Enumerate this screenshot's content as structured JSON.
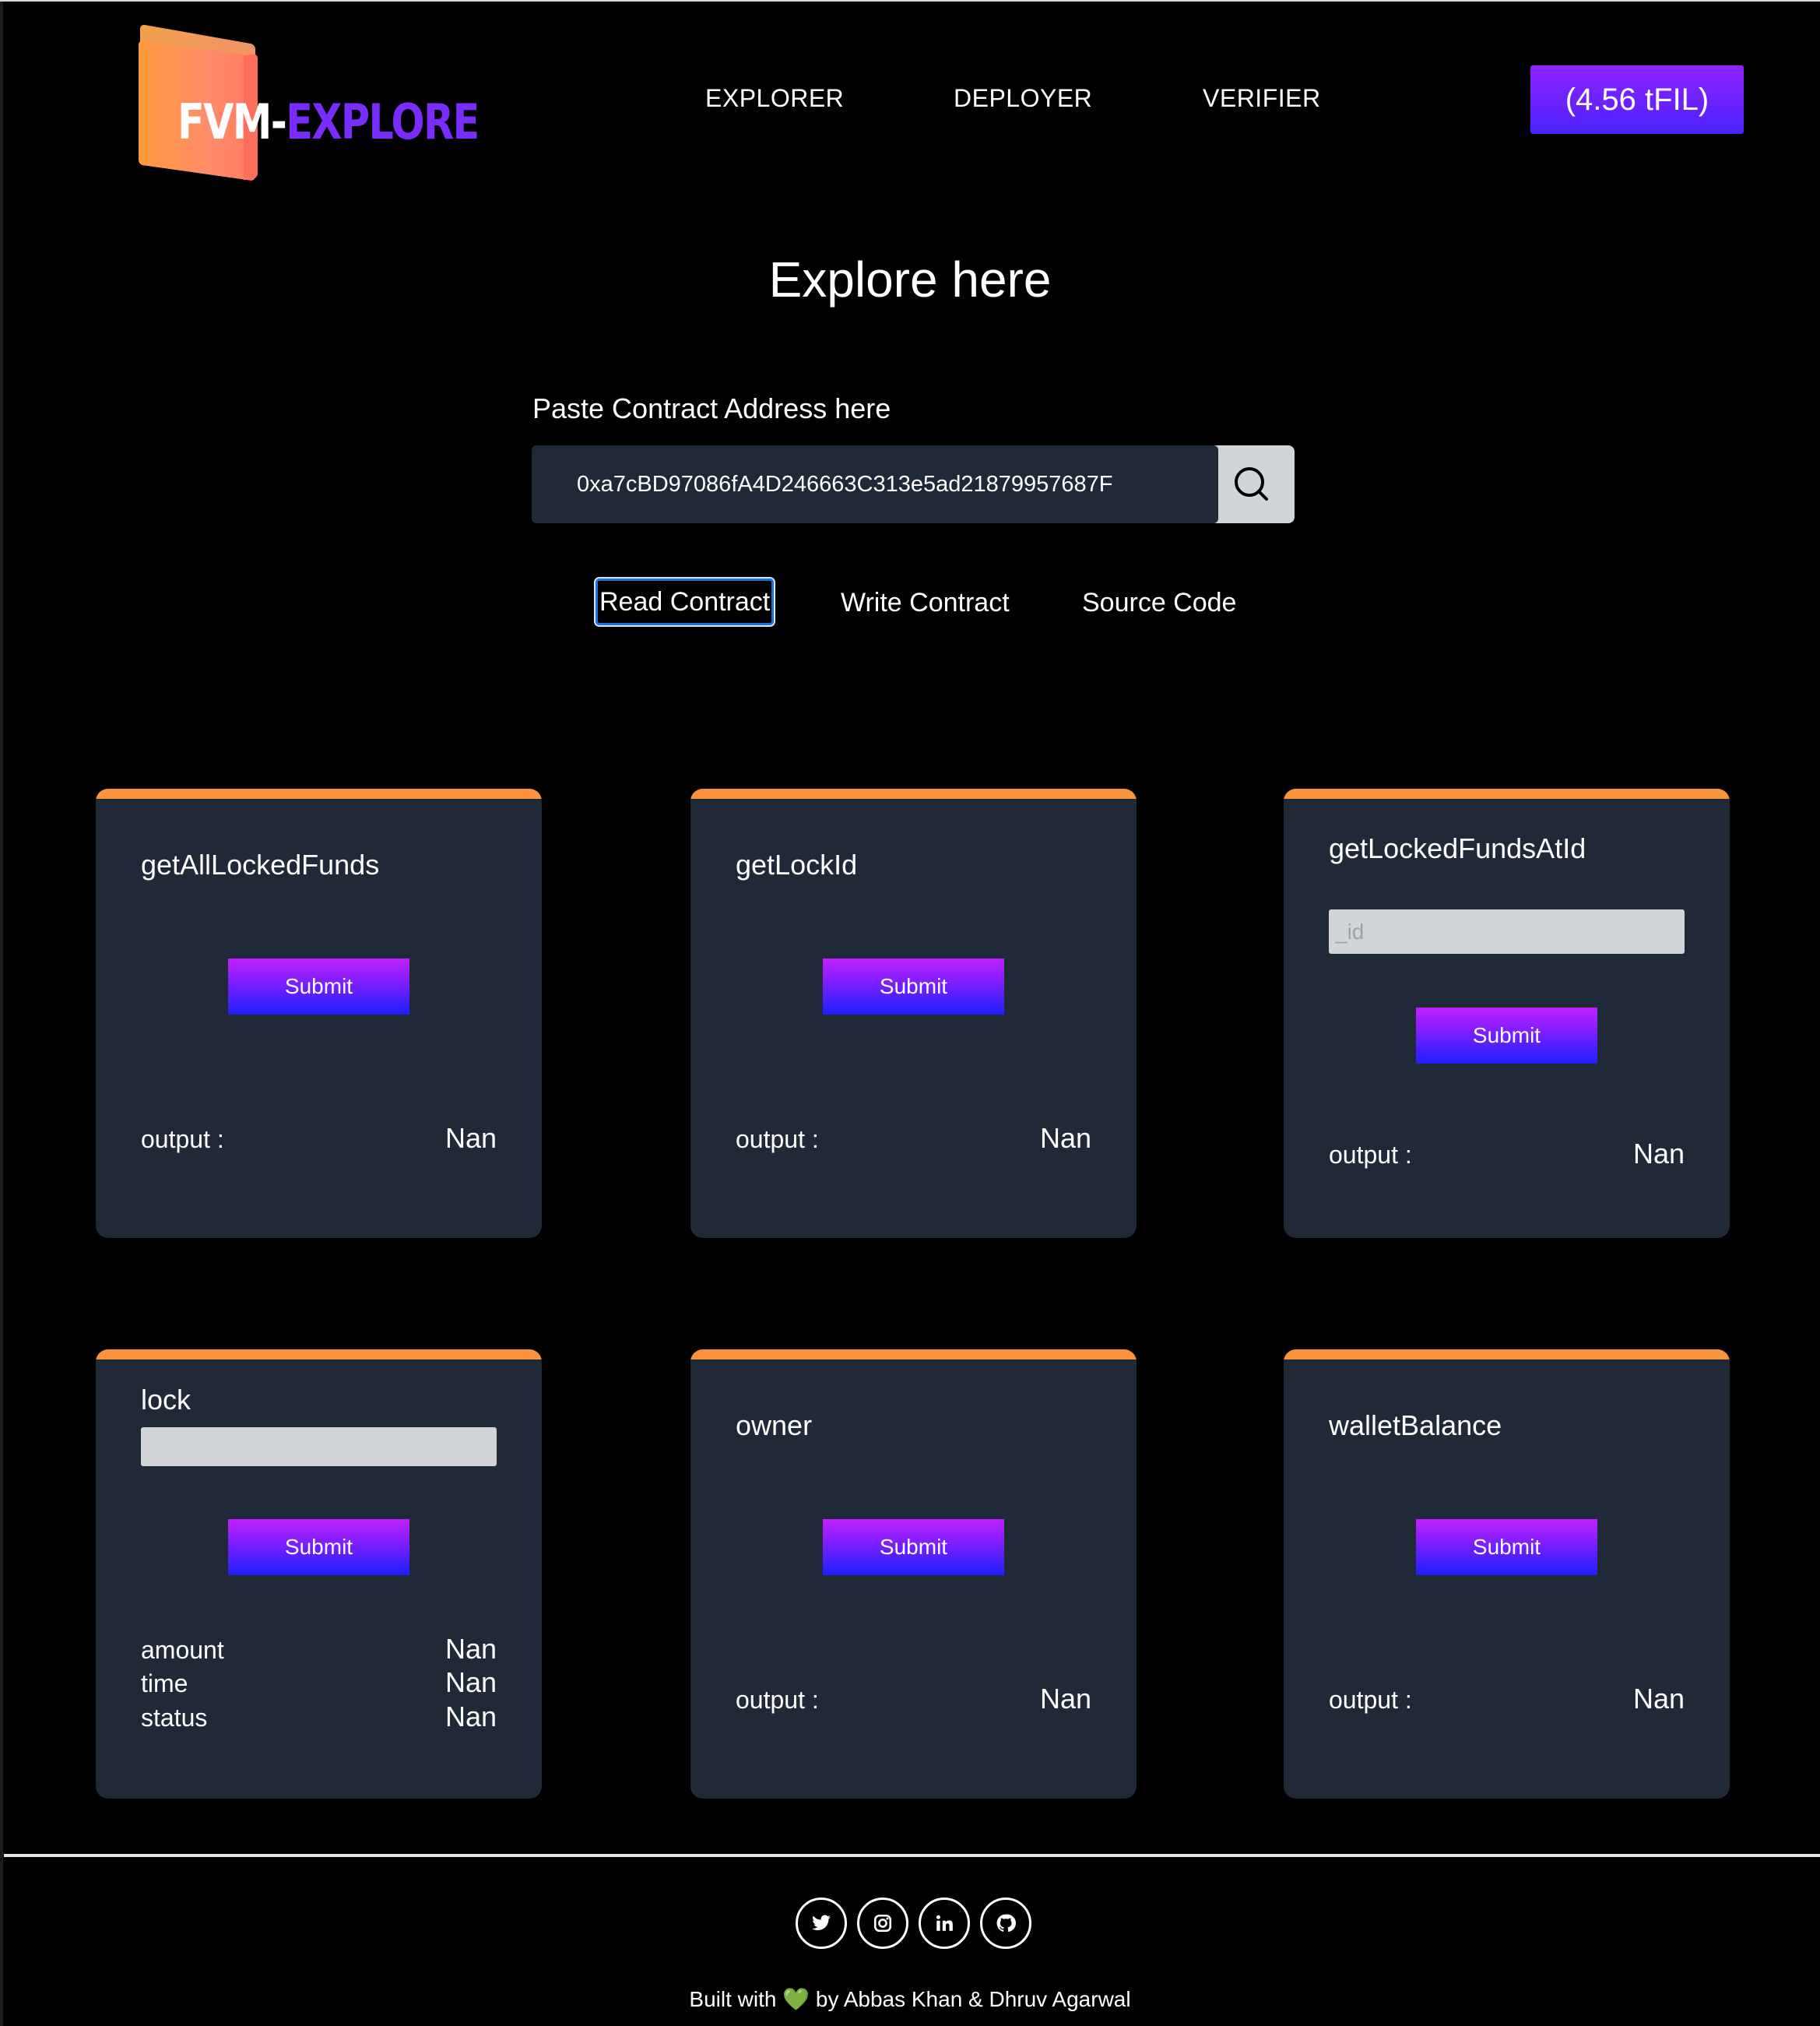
{
  "brand": {
    "part1": "FVM",
    "dash": "-",
    "part2": "EXPLORE"
  },
  "nav": {
    "links": [
      "EXPLORER",
      "DEPLOYER",
      "VERIFIER"
    ],
    "balance": "(4.56 tFIL)"
  },
  "hero": {
    "title": "Explore here",
    "address_label": "Paste Contract Address here",
    "address_value": "0xa7cBD97086fA4D246663C313e5ad21879957687F"
  },
  "tabs": [
    {
      "label": "Read Contract",
      "active": true
    },
    {
      "label": "Write Contract",
      "active": false
    },
    {
      "label": "Source Code",
      "active": false
    }
  ],
  "cards": [
    {
      "title": "getAllLockedFunds",
      "submit": "Submit",
      "outputs": [
        {
          "label": "output :",
          "value": "Nan"
        }
      ]
    },
    {
      "title": "getLockId",
      "submit": "Submit",
      "outputs": [
        {
          "label": "output :",
          "value": "Nan"
        }
      ]
    },
    {
      "title": "getLockedFundsAtId",
      "input_placeholder": "_id",
      "submit": "Submit",
      "outputs": [
        {
          "label": "output :",
          "value": "Nan"
        }
      ]
    },
    {
      "title": "lock",
      "input_placeholder": "",
      "submit": "Submit",
      "outputs": [
        {
          "label": "amount",
          "value": "Nan"
        },
        {
          "label": "time",
          "value": "Nan"
        },
        {
          "label": "status",
          "value": "Nan"
        }
      ]
    },
    {
      "title": "owner",
      "submit": "Submit",
      "outputs": [
        {
          "label": "output :",
          "value": "Nan"
        }
      ]
    },
    {
      "title": "walletBalance",
      "submit": "Submit",
      "outputs": [
        {
          "label": "output :",
          "value": "Nan"
        }
      ]
    }
  ],
  "footer": {
    "social": [
      "twitter-icon",
      "instagram-icon",
      "linkedin-icon",
      "github-icon"
    ],
    "credit_prefix": "Built with",
    "heart": "💚",
    "credit_suffix": "by Abbas Khan & Dhruv Agarwal"
  },
  "colors": {
    "card_bg": "#1f2937",
    "card_accent": "#fb923c",
    "button_gradient_top": "#c21fff",
    "button_gradient_bottom": "#1f1fff",
    "brand_purple": "#7a2cff"
  }
}
